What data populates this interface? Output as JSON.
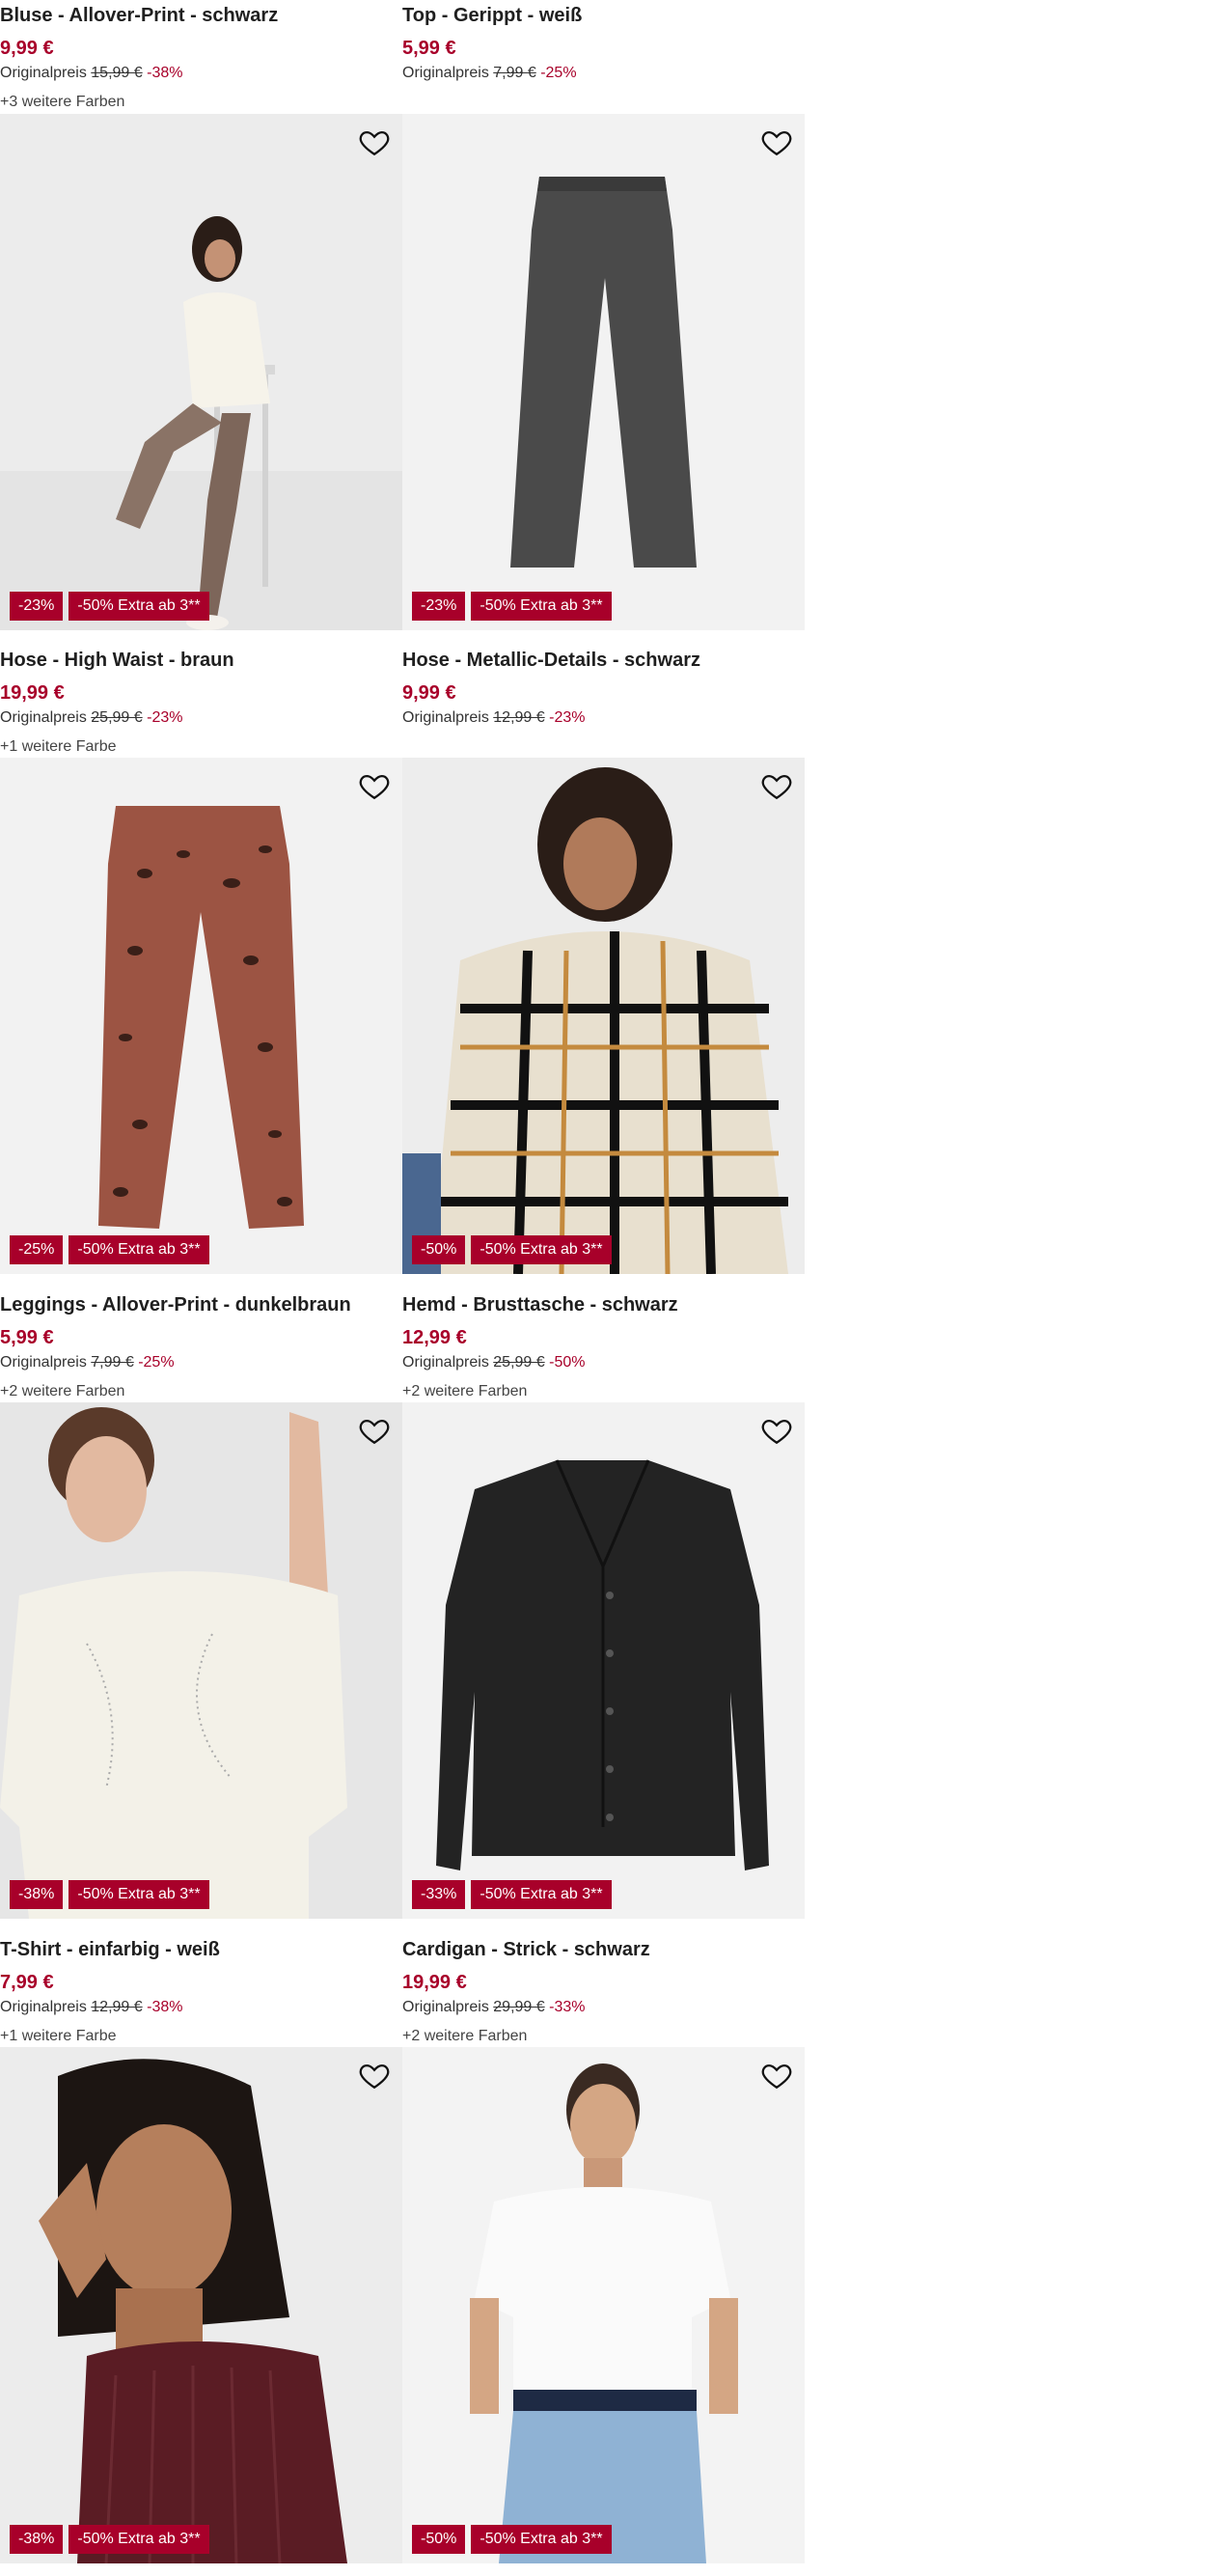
{
  "products": [
    {
      "title": "Bluse - Allover-Print - schwarz",
      "price": "9,99 €",
      "orig_label": "Originalpreis",
      "orig_price": "15,99 €",
      "discount": "-38%",
      "colors": "+3 weitere Farben"
    },
    {
      "title": "Top - Gerippt - weiß",
      "price": "5,99 €",
      "orig_label": "Originalpreis",
      "orig_price": "7,99 €",
      "discount": "-25%",
      "colors": ""
    },
    {
      "title": "Hose - High Waist - braun",
      "price": "19,99 €",
      "orig_label": "Originalpreis",
      "orig_price": "25,99 €",
      "discount": "-23%",
      "colors": "+1 weitere Farbe",
      "badge": "-23%",
      "extra": "-50% Extra ab 3**"
    },
    {
      "title": "Hose - Metallic-Details - schwarz",
      "price": "9,99 €",
      "orig_label": "Originalpreis",
      "orig_price": "12,99 €",
      "discount": "-23%",
      "colors": "",
      "badge": "-23%",
      "extra": "-50% Extra ab 3**"
    },
    {
      "title": "Leggings - Allover-Print - dunkelbraun",
      "price": "5,99 €",
      "orig_label": "Originalpreis",
      "orig_price": "7,99 €",
      "discount": "-25%",
      "colors": "+2 weitere Farben",
      "badge": "-25%",
      "extra": "-50% Extra ab 3**"
    },
    {
      "title": "Hemd - Brusttasche - schwarz",
      "price": "12,99 €",
      "orig_label": "Originalpreis",
      "orig_price": "25,99 €",
      "discount": "-50%",
      "colors": "+2 weitere Farben",
      "badge": "-50%",
      "extra": "-50% Extra ab 3**"
    },
    {
      "title": "T-Shirt - einfarbig - weiß",
      "price": "7,99 €",
      "orig_label": "Originalpreis",
      "orig_price": "12,99 €",
      "discount": "-38%",
      "colors": "+1 weitere Farbe",
      "badge": "-38%",
      "extra": "-50% Extra ab 3**"
    },
    {
      "title": "Cardigan - Strick - schwarz",
      "price": "19,99 €",
      "orig_label": "Originalpreis",
      "orig_price": "29,99 €",
      "discount": "-33%",
      "colors": "+2 weitere Farben",
      "badge": "-33%",
      "extra": "-50% Extra ab 3**"
    },
    {
      "title": "",
      "price": "",
      "orig_label": "",
      "orig_price": "",
      "discount": "",
      "colors": "",
      "badge": "-38%",
      "extra": "-50% Extra ab 3**"
    },
    {
      "title": "",
      "price": "",
      "orig_label": "",
      "orig_price": "",
      "discount": "",
      "colors": "",
      "badge": "-50%",
      "extra": "-50% Extra ab 3**"
    }
  ],
  "icons": {
    "favorite": "heart-outline-icon"
  },
  "colors": {
    "accent": "#a8002a",
    "tile_bg": "#f0f0f0"
  }
}
